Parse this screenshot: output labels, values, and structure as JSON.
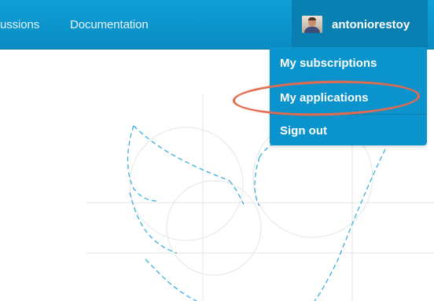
{
  "navbar": {
    "discussions_label": "ussions",
    "documentation_label": "Documentation",
    "background_color": "#0a95cf"
  },
  "user_menu": {
    "username": "antoniorestoy",
    "avatar_icon": "user-avatar-photo",
    "items": [
      {
        "label": "My subscriptions"
      },
      {
        "label": "My applications"
      },
      {
        "label": "Sign out"
      }
    ],
    "highlighted_item": "My applications",
    "highlight_color": "#e46a4f"
  },
  "background_graphic": {
    "icon": "dashed-bird-logo-construction-sketch",
    "stroke_color": "#3aaee0"
  }
}
